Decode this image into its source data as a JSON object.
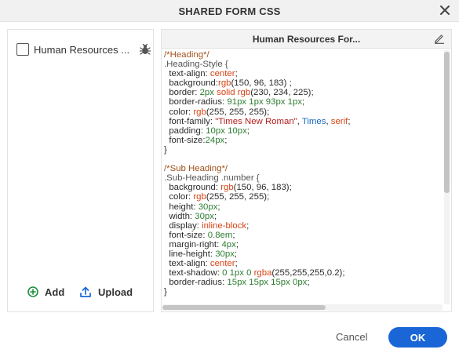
{
  "dialog": {
    "title": "SHARED FORM CSS",
    "close_icon": "close-icon"
  },
  "left_panel": {
    "file_item": {
      "label": "Human Resources ...",
      "checked": false,
      "icon": "bug-icon"
    },
    "actions": {
      "add_label": "Add",
      "add_icon": "plus-circle-icon",
      "upload_label": "Upload",
      "upload_icon": "upload-icon",
      "accent": "#1e8e3e",
      "upload_color": "#1a66d6"
    }
  },
  "editor": {
    "title": "Human Resources For...",
    "edit_icon": "pencil-icon",
    "lines": [
      [
        [
          "/*Heading*/",
          "com"
        ]
      ],
      [
        [
          ".Heading-Style {",
          "sel"
        ]
      ],
      [
        [
          "  text-align: ",
          ""
        ],
        [
          "center",
          "kw"
        ],
        [
          ";",
          ""
        ]
      ],
      [
        [
          "  background:",
          ""
        ],
        [
          "rgb",
          "kw"
        ],
        [
          "(150, 96, 183) ;",
          ""
        ]
      ],
      [
        [
          "  border: ",
          ""
        ],
        [
          "2px",
          "num"
        ],
        [
          " solid ",
          "kw"
        ],
        [
          "rgb",
          "kw"
        ],
        [
          "(230, 234, 225);",
          ""
        ]
      ],
      [
        [
          "  border-radius: ",
          ""
        ],
        [
          "91px 1px 93px 1px",
          "num"
        ],
        [
          ";",
          ""
        ]
      ],
      [
        [
          "  color: ",
          ""
        ],
        [
          "rgb",
          "kw"
        ],
        [
          "(255, 255, 255);",
          ""
        ]
      ],
      [
        [
          "  font-family: ",
          ""
        ],
        [
          "\"Times New Roman\"",
          "str"
        ],
        [
          ", ",
          ""
        ],
        [
          "Times",
          "blue"
        ],
        [
          ", ",
          ""
        ],
        [
          "serif",
          "kw"
        ],
        [
          ";",
          ""
        ]
      ],
      [
        [
          "  padding: ",
          ""
        ],
        [
          "10px 10px",
          "num"
        ],
        [
          ";",
          ""
        ]
      ],
      [
        [
          "  font-size:",
          ""
        ],
        [
          "24px",
          "num"
        ],
        [
          ";",
          ""
        ]
      ],
      [
        [
          "}",
          ""
        ]
      ],
      [
        [
          "",
          ""
        ]
      ],
      [
        [
          "/*Sub Heading*/",
          "com"
        ]
      ],
      [
        [
          ".Sub-Heading .number {",
          "sel"
        ]
      ],
      [
        [
          "  background: ",
          ""
        ],
        [
          "rgb",
          "kw"
        ],
        [
          "(150, 96, 183);",
          ""
        ]
      ],
      [
        [
          "  color: ",
          ""
        ],
        [
          "rgb",
          "kw"
        ],
        [
          "(255, 255, 255);",
          ""
        ]
      ],
      [
        [
          "  height: ",
          ""
        ],
        [
          "30px",
          "num"
        ],
        [
          ";",
          ""
        ]
      ],
      [
        [
          "  width: ",
          ""
        ],
        [
          "30px",
          "num"
        ],
        [
          ";",
          ""
        ]
      ],
      [
        [
          "  display: ",
          ""
        ],
        [
          "inline-block",
          "kw"
        ],
        [
          ";",
          ""
        ]
      ],
      [
        [
          "  font-size: ",
          ""
        ],
        [
          "0.8em",
          "num"
        ],
        [
          ";",
          ""
        ]
      ],
      [
        [
          "  margin-right: ",
          ""
        ],
        [
          "4px",
          "num"
        ],
        [
          ";",
          ""
        ]
      ],
      [
        [
          "  line-height: ",
          ""
        ],
        [
          "30px",
          "num"
        ],
        [
          ";",
          ""
        ]
      ],
      [
        [
          "  text-align: ",
          ""
        ],
        [
          "center",
          "kw"
        ],
        [
          ";",
          ""
        ]
      ],
      [
        [
          "  text-shadow: ",
          ""
        ],
        [
          "0 1px 0 ",
          "num"
        ],
        [
          "rgba",
          "kw"
        ],
        [
          "(255,255,255,0.2);",
          ""
        ]
      ],
      [
        [
          "  border-radius: ",
          ""
        ],
        [
          "15px 15px 15px 0px",
          "num"
        ],
        [
          ";",
          ""
        ]
      ],
      [
        [
          "}",
          ""
        ]
      ]
    ]
  },
  "footer": {
    "cancel_label": "Cancel",
    "ok_label": "OK",
    "ok_color": "#1a66d6"
  }
}
